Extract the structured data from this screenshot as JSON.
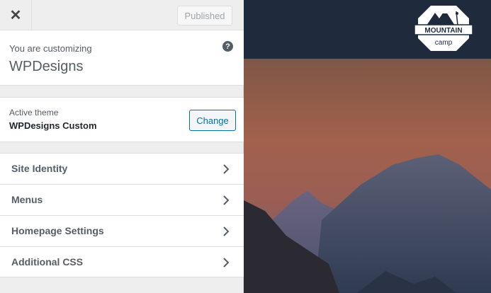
{
  "topbar": {
    "close_icon": "close-icon",
    "published_label": "Published"
  },
  "info": {
    "label": "You are customizing",
    "site_title": "WPDesigns",
    "help_icon": "question-icon",
    "help_glyph": "?"
  },
  "theme": {
    "label": "Active theme",
    "name": "WPDesigns Custom",
    "change_label": "Change"
  },
  "menu": {
    "items": [
      {
        "label": "Site Identity"
      },
      {
        "label": "Menus"
      },
      {
        "label": "Homepage Settings"
      },
      {
        "label": "Additional CSS"
      }
    ]
  },
  "preview": {
    "logo_line1": "MOUNTAIN",
    "logo_line2": "camp"
  },
  "colors": {
    "panel_bg": "#eeeeee",
    "accent": "#0073aa",
    "header_bg": "#1f2b3c"
  }
}
